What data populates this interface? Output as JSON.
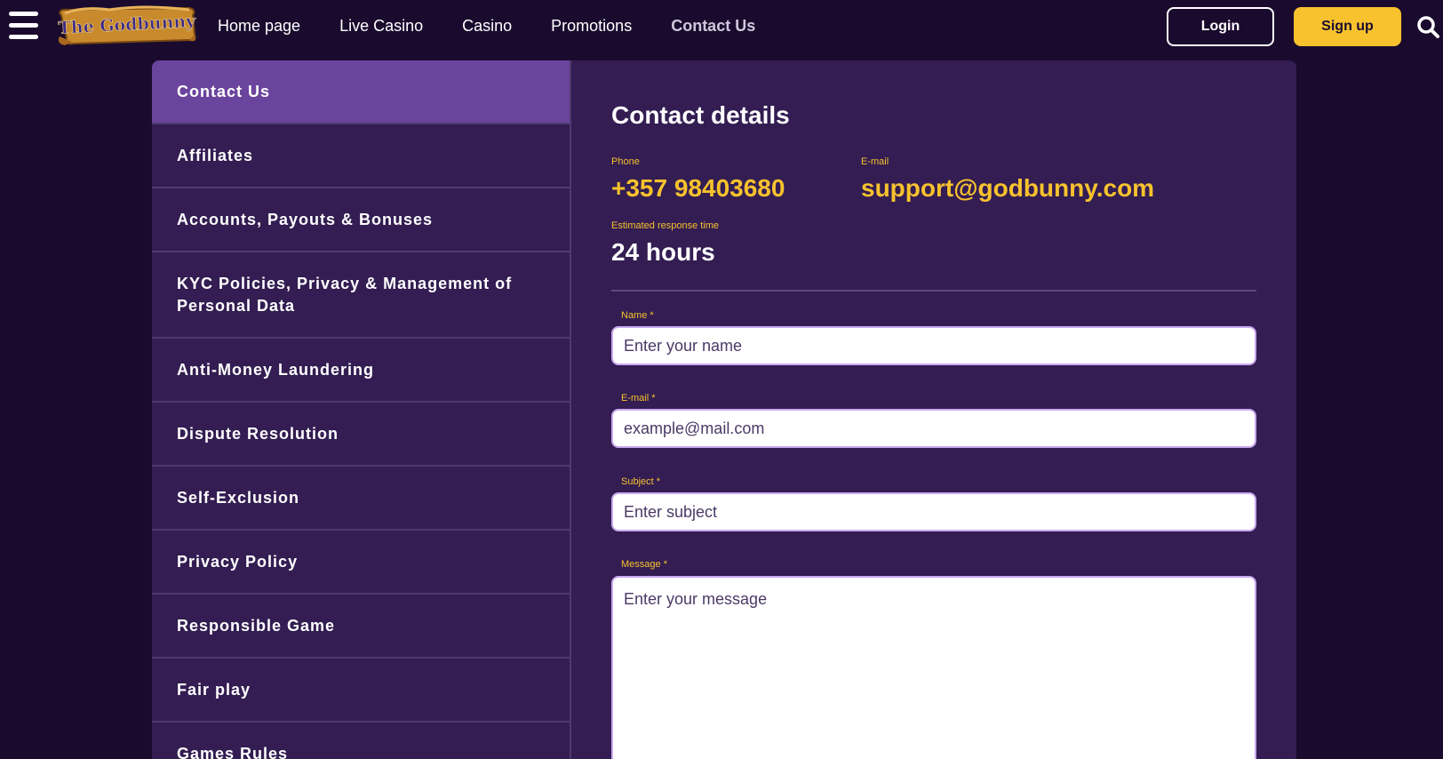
{
  "header": {
    "logo_text": "The Godbunny",
    "nav": [
      {
        "label": "Home page"
      },
      {
        "label": "Live Casino"
      },
      {
        "label": "Casino"
      },
      {
        "label": "Promotions"
      },
      {
        "label": "Contact Us",
        "active": true
      }
    ],
    "login_label": "Login",
    "signup_label": "Sign up"
  },
  "sidebar": {
    "items": [
      {
        "label": "Contact Us",
        "active": true
      },
      {
        "label": "Affiliates"
      },
      {
        "label": "Accounts, Payouts & Bonuses"
      },
      {
        "label": "KYC Policies, Privacy & Management of Personal Data"
      },
      {
        "label": "Anti-Money Laundering"
      },
      {
        "label": "Dispute Resolution"
      },
      {
        "label": "Self-Exclusion"
      },
      {
        "label": "Privacy Policy"
      },
      {
        "label": "Responsible Game"
      },
      {
        "label": "Fair play"
      },
      {
        "label": "Games Rules"
      }
    ]
  },
  "contact": {
    "title": "Contact details",
    "phone_label": "Phone",
    "phone": "+357 98403680",
    "email_label": "E-mail",
    "email": "support@godbunny.com",
    "response_label": "Estimated response time",
    "response_time": "24 hours"
  },
  "form": {
    "name_label": "Name *",
    "name_placeholder": "Enter your name",
    "email_label": "E-mail *",
    "email_placeholder": "example@mail.com",
    "subject_label": "Subject *",
    "subject_placeholder": "Enter subject",
    "message_label": "Message *",
    "message_placeholder": "Enter your message"
  },
  "colors": {
    "background": "#1a0b2e",
    "panel": "#331d52",
    "active_item": "#6b449e",
    "accent_yellow": "#f7c22e"
  },
  "icons": {
    "menu": "hamburger-menu-icon",
    "search": "search-icon"
  }
}
